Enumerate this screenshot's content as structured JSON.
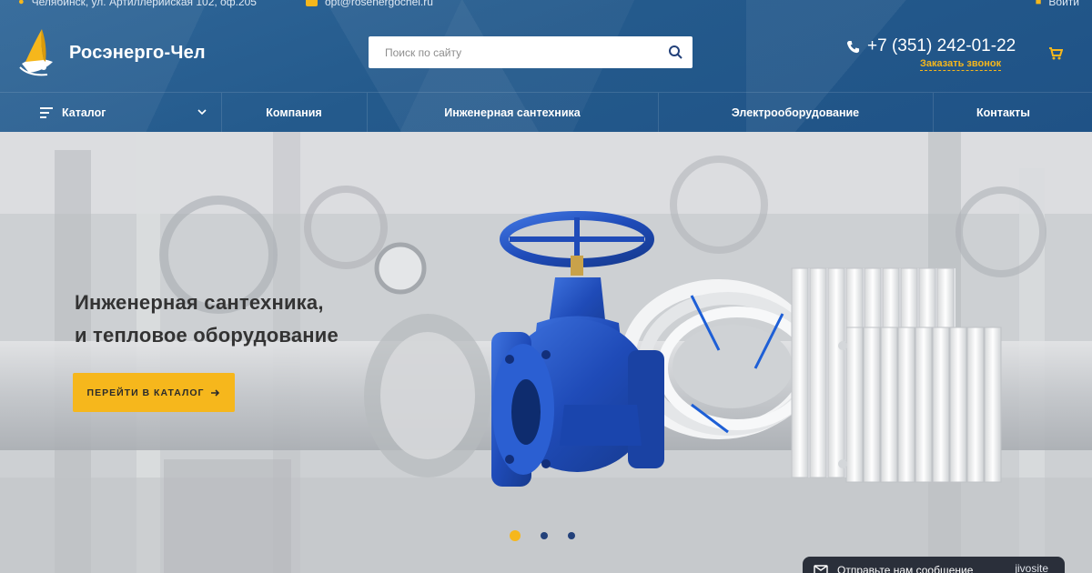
{
  "topbar": {
    "address": "Челябинск, ул. Артиллерийская 102, оф.205",
    "email": "opt@rosenergochel.ru",
    "login": "Войти"
  },
  "header": {
    "logo_text": "Росэнерго-Чел",
    "search_placeholder": "Поиск по сайту",
    "phone": "+7 (351) 242-01-22",
    "callback": "Заказать звонок"
  },
  "nav": {
    "catalog": "Каталог",
    "company": "Компания",
    "plumbing": "Инженерная сантехника",
    "electric": "Электрооборудование",
    "contacts": "Контакты"
  },
  "hero": {
    "title_line1": "Инженерная сантехника,",
    "title_line2": "и тепловое оборудование",
    "button": "ПЕРЕЙТИ В КАТАЛОГ",
    "slides_total": 3,
    "slide_active": 1
  },
  "chat": {
    "label": "Отправьте нам сообщение",
    "brand": "jivosite"
  },
  "colors": {
    "accent": "#f6b71c",
    "header": "#245a8c",
    "valve": "#1f4bb8",
    "text_dark": "#333333"
  },
  "icons": [
    "map-pin-icon",
    "mail-icon",
    "lock-icon",
    "search-icon",
    "phone-icon",
    "cart-icon",
    "menu-icon",
    "chevron-down-icon",
    "arrow-right-icon",
    "chat-icon"
  ]
}
